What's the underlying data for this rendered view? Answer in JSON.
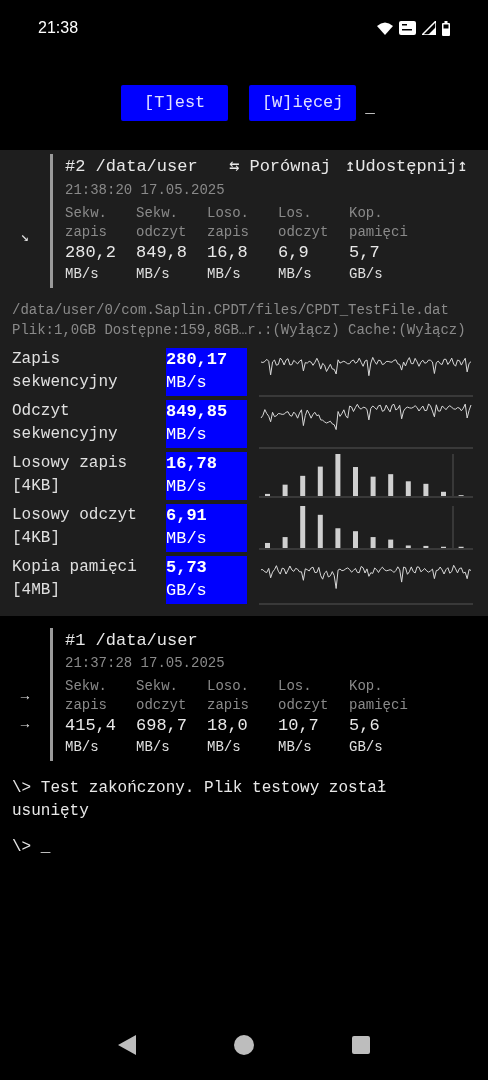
{
  "status_bar": {
    "time": "21:38"
  },
  "toolbar": {
    "buttons": [
      "[T]est",
      "[W]ięcej"
    ],
    "cursor": "_"
  },
  "runs": [
    {
      "title": "#2 /data/user",
      "actions": [
        "⇆ Porównaj",
        "↥Udostępnij↥"
      ],
      "timestamp": "21:38:20 17.05.2025",
      "markers": [
        "↘"
      ],
      "expanded": true,
      "metrics": [
        {
          "label": "Sekw. zapis",
          "value": "280,2",
          "unit": "MB/s"
        },
        {
          "label": "Sekw. odczyt",
          "value": "849,8",
          "unit": "MB/s"
        },
        {
          "label": "Loso. zapis",
          "value": "16,8",
          "unit": "MB/s"
        },
        {
          "label": "Los. odczyt",
          "value": "6,9",
          "unit": "MB/s"
        },
        {
          "label": "Kop. pamięci",
          "value": "5,7",
          "unit": "GB/s"
        }
      ],
      "details": {
        "path": "/data/user/0/com.Saplin.CPDT/files/CPDT_TestFile.dat",
        "info": "Plik:1,0GB Dostępne:159,8GB…r.:(Wyłącz) Cache:(Wyłącz)",
        "results": [
          {
            "name": "Zapis sekwencyjny",
            "value": "280,17",
            "unit": "MB/s",
            "kind": "line"
          },
          {
            "name": "Odczyt sekwencyjny",
            "value": "849,85",
            "unit": "MB/s",
            "kind": "line"
          },
          {
            "name": "Losowy zapis [4KB]",
            "value": "16,78",
            "unit": "MB/s",
            "kind": "bars"
          },
          {
            "name": "Losowy odczyt [4KB]",
            "value": "6,91",
            "unit": "MB/s",
            "kind": "bars"
          },
          {
            "name": "Kopia pamięci [4MB]",
            "value": "5,73",
            "unit": "GB/s",
            "kind": "line"
          }
        ]
      }
    },
    {
      "title": "#1 /data/user",
      "timestamp": "21:37:28 17.05.2025",
      "markers": [
        "→",
        "→"
      ],
      "expanded": false,
      "metrics": [
        {
          "label": "Sekw. zapis",
          "value": "415,4",
          "unit": "MB/s"
        },
        {
          "label": "Sekw. odczyt",
          "value": "698,7",
          "unit": "MB/s"
        },
        {
          "label": "Loso. zapis",
          "value": "18,0",
          "unit": "MB/s"
        },
        {
          "label": "Los. odczyt",
          "value": "10,7",
          "unit": "MB/s"
        },
        {
          "label": "Kop. pamięci",
          "value": "5,6",
          "unit": "GB/s"
        }
      ]
    }
  ],
  "log": [
    "\\> Test zakończony. Plik testowy został usunięty"
  ],
  "prompt": "\\> _"
}
